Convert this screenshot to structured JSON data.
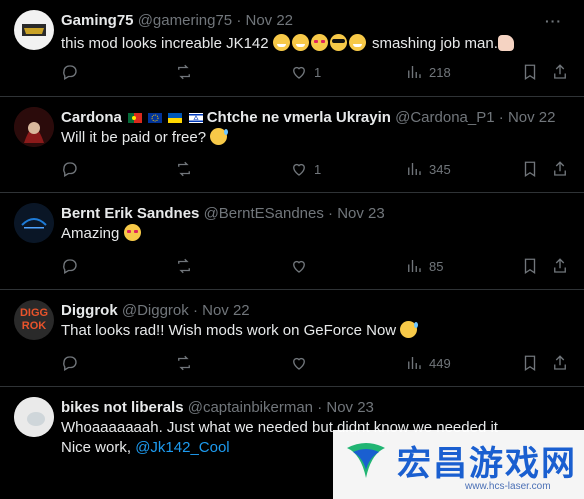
{
  "tweets": [
    {
      "name": "Gaming75",
      "handle": "@gamering75",
      "date": "Nov 22",
      "text": "this mod looks increable JK142",
      "text_after": "smashing job man.",
      "stats": {
        "reply": "",
        "retweet": "",
        "like": "1",
        "views": "218"
      }
    },
    {
      "name": "Cardona",
      "name_suffix": "Chtche ne vmerla Ukrayin",
      "handle": "@Cardona_P1",
      "date": "Nov 22",
      "text": "Will it be paid or free?",
      "stats": {
        "reply": "",
        "retweet": "",
        "like": "1",
        "views": "345"
      }
    },
    {
      "name": "Bernt Erik Sandnes",
      "handle": "@BerntESandnes",
      "date": "Nov 23",
      "text": "Amazing",
      "stats": {
        "reply": "",
        "retweet": "",
        "like": "",
        "views": "85"
      }
    },
    {
      "name": "Diggrok",
      "handle": "@Diggrok",
      "date": "Nov 22",
      "text": "That looks rad!! Wish mods work on GeForce Now",
      "avatar_text": "DIGG ROK",
      "stats": {
        "reply": "",
        "retweet": "",
        "like": "",
        "views": "449"
      }
    },
    {
      "name": "bikes not liberals",
      "handle": "@captainbikerman",
      "date": "Nov 23",
      "text": "Whoaaaaaaah. Just what we needed but didnt know we needed it",
      "text_line2": "Nice work,",
      "mention": "@Jk142_Cool"
    }
  ],
  "separator": "·",
  "more_glyph": "···",
  "watermark": {
    "title": "宏昌游戏网",
    "url": "www.hcs-laser.com"
  },
  "colors": {
    "bg": "#000000",
    "text": "#e7e9ea",
    "muted": "#71767b",
    "link": "#1d9bf0",
    "divider": "#2f3336"
  }
}
